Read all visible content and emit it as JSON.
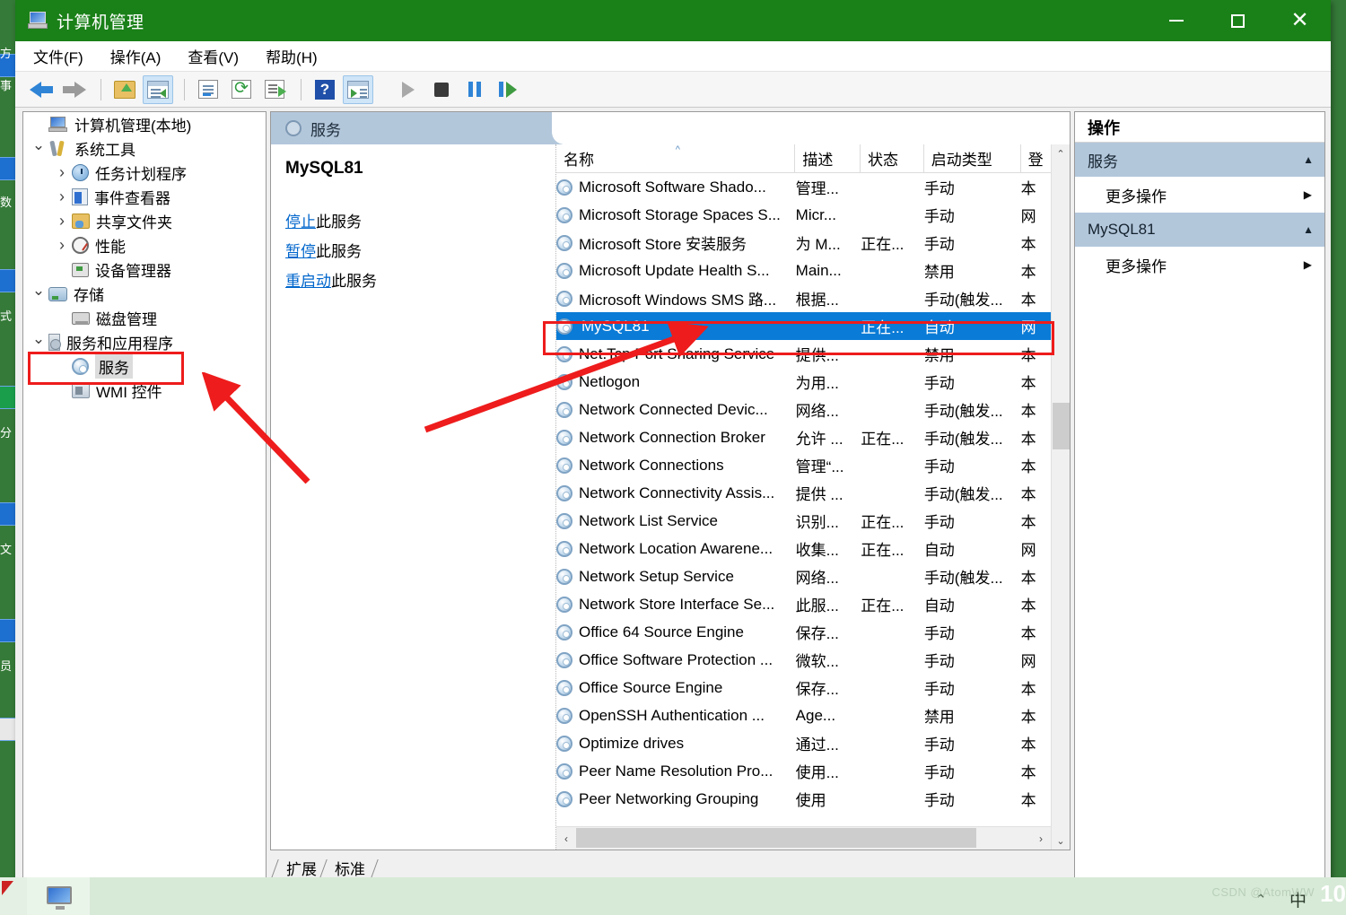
{
  "window": {
    "title": "计算机管理",
    "title_icon": "computer-management-icon",
    "controls": {
      "minimize": "最小化",
      "maximize": "最大化",
      "close": "关闭"
    }
  },
  "menubar": [
    {
      "name": "file",
      "label": "文件(F)"
    },
    {
      "name": "action",
      "label": "操作(A)"
    },
    {
      "name": "view",
      "label": "查看(V)"
    },
    {
      "name": "help",
      "label": "帮助(H)"
    }
  ],
  "toolbar": [
    {
      "name": "back-icon",
      "label": "后退"
    },
    {
      "name": "forward-icon",
      "label": "前进"
    },
    {
      "name": "up-one-level-icon",
      "label": "上移一级"
    },
    {
      "name": "show-hide-tree-icon",
      "label": "显示/隐藏控制台树"
    },
    {
      "name": "properties-icon",
      "label": "属性"
    },
    {
      "name": "refresh-icon",
      "label": "刷新"
    },
    {
      "name": "export-list-icon",
      "label": "导出列表"
    },
    {
      "name": "help-icon",
      "label": "帮助"
    },
    {
      "name": "show-action-pane-icon",
      "label": "显示/隐藏操作窗格"
    },
    {
      "name": "start-service-icon",
      "label": "启动服务"
    },
    {
      "name": "stop-service-icon",
      "label": "停止服务"
    },
    {
      "name": "pause-service-icon",
      "label": "暂停服务"
    },
    {
      "name": "restart-service-icon",
      "label": "重新启动服务"
    }
  ],
  "tree": {
    "root": {
      "label": "计算机管理(本地)",
      "icon": "computer-icon"
    },
    "items": [
      {
        "label": "系统工具",
        "icon": "tools-icon",
        "indent": 1,
        "twisty": "expanded"
      },
      {
        "label": "任务计划程序",
        "icon": "clock-icon",
        "indent": 2,
        "twisty": "collapsed"
      },
      {
        "label": "事件查看器",
        "icon": "event-viewer-icon",
        "indent": 2,
        "twisty": "collapsed"
      },
      {
        "label": "共享文件夹",
        "icon": "shared-folder-icon",
        "indent": 2,
        "twisty": "collapsed"
      },
      {
        "label": "性能",
        "icon": "performance-icon",
        "indent": 2,
        "twisty": "collapsed"
      },
      {
        "label": "设备管理器",
        "icon": "device-manager-icon",
        "indent": 2,
        "twisty": "none"
      },
      {
        "label": "存储",
        "icon": "storage-icon",
        "indent": 1,
        "twisty": "expanded"
      },
      {
        "label": "磁盘管理",
        "icon": "disk-management-icon",
        "indent": 2,
        "twisty": "none"
      },
      {
        "label": "服务和应用程序",
        "icon": "services-apps-icon",
        "indent": 1,
        "twisty": "expanded"
      },
      {
        "label": "服务",
        "icon": "services-gear-icon",
        "indent": 2,
        "twisty": "none",
        "selected": true
      },
      {
        "label": "WMI 控件",
        "icon": "wmi-control-icon",
        "indent": 2,
        "twisty": "none"
      }
    ]
  },
  "center": {
    "header_title": "服务",
    "header_icon": "services-gear-icon",
    "detail": {
      "title": "MySQL81",
      "links": [
        {
          "link_text": "停止",
          "suffix": "此服务"
        },
        {
          "link_text": "暂停",
          "suffix": "此服务"
        },
        {
          "link_text": "重启动",
          "suffix": "此服务"
        }
      ]
    },
    "columns": [
      {
        "key": "name",
        "label": "名称",
        "sorted": true,
        "sort_mark": "^"
      },
      {
        "key": "description",
        "label": "描述"
      },
      {
        "key": "status",
        "label": "状态"
      },
      {
        "key": "startup_type",
        "label": "启动类型"
      },
      {
        "key": "log_on_as",
        "label": "登"
      }
    ],
    "rows": [
      {
        "name": "Microsoft Software Shado...",
        "description": "管理...",
        "status": "",
        "startup_type": "手动",
        "log_on_as": "本",
        "selected": false
      },
      {
        "name": "Microsoft Storage Spaces S...",
        "description": "Micr...",
        "status": "",
        "startup_type": "手动",
        "log_on_as": "网",
        "selected": false
      },
      {
        "name": "Microsoft Store 安装服务",
        "description": "为 M...",
        "status": "正在...",
        "startup_type": "手动",
        "log_on_as": "本",
        "selected": false
      },
      {
        "name": "Microsoft Update Health S...",
        "description": "Main...",
        "status": "",
        "startup_type": "禁用",
        "log_on_as": "本",
        "selected": false
      },
      {
        "name": "Microsoft Windows SMS 路...",
        "description": "根据...",
        "status": "",
        "startup_type": "手动(触发...",
        "log_on_as": "本",
        "selected": false
      },
      {
        "name": "MySQL81",
        "description": "",
        "status": "正在...",
        "startup_type": "自动",
        "log_on_as": "网",
        "selected": true
      },
      {
        "name": "Net.Tcp Port Sharing Service",
        "description": "提供...",
        "status": "",
        "startup_type": "禁用",
        "log_on_as": "本",
        "selected": false
      },
      {
        "name": "Netlogon",
        "description": "为用...",
        "status": "",
        "startup_type": "手动",
        "log_on_as": "本",
        "selected": false
      },
      {
        "name": "Network Connected Devic...",
        "description": "网络...",
        "status": "",
        "startup_type": "手动(触发...",
        "log_on_as": "本",
        "selected": false
      },
      {
        "name": "Network Connection Broker",
        "description": "允许 ...",
        "status": "正在...",
        "startup_type": "手动(触发...",
        "log_on_as": "本",
        "selected": false
      },
      {
        "name": "Network Connections",
        "description": "管理“...",
        "status": "",
        "startup_type": "手动",
        "log_on_as": "本",
        "selected": false
      },
      {
        "name": "Network Connectivity Assis...",
        "description": "提供 ...",
        "status": "",
        "startup_type": "手动(触发...",
        "log_on_as": "本",
        "selected": false
      },
      {
        "name": "Network List Service",
        "description": "识别...",
        "status": "正在...",
        "startup_type": "手动",
        "log_on_as": "本",
        "selected": false
      },
      {
        "name": "Network Location Awarene...",
        "description": "收集...",
        "status": "正在...",
        "startup_type": "自动",
        "log_on_as": "网",
        "selected": false
      },
      {
        "name": "Network Setup Service",
        "description": "网络...",
        "status": "",
        "startup_type": "手动(触发...",
        "log_on_as": "本",
        "selected": false
      },
      {
        "name": "Network Store Interface Se...",
        "description": "此服...",
        "status": "正在...",
        "startup_type": "自动",
        "log_on_as": "本",
        "selected": false
      },
      {
        "name": "Office 64 Source Engine",
        "description": "保存...",
        "status": "",
        "startup_type": "手动",
        "log_on_as": "本",
        "selected": false
      },
      {
        "name": "Office Software Protection ...",
        "description": "微软...",
        "status": "",
        "startup_type": "手动",
        "log_on_as": "网",
        "selected": false
      },
      {
        "name": "Office Source Engine",
        "description": "保存...",
        "status": "",
        "startup_type": "手动",
        "log_on_as": "本",
        "selected": false
      },
      {
        "name": "OpenSSH Authentication ...",
        "description": "Age...",
        "status": "",
        "startup_type": "禁用",
        "log_on_as": "本",
        "selected": false
      },
      {
        "name": "Optimize drives",
        "description": "通过...",
        "status": "",
        "startup_type": "手动",
        "log_on_as": "本",
        "selected": false
      },
      {
        "name": "Peer Name Resolution Pro...",
        "description": "使用...",
        "status": "",
        "startup_type": "手动",
        "log_on_as": "本",
        "selected": false
      },
      {
        "name": "Peer Networking Grouping",
        "description": "使用",
        "status": "",
        "startup_type": "手动",
        "log_on_as": "本",
        "selected": false
      }
    ],
    "view_tabs": [
      {
        "name": "extended",
        "label": "扩展"
      },
      {
        "name": "standard",
        "label": "标准",
        "active": true
      }
    ],
    "scroll": {
      "up_arrow": "⌃",
      "down_arrow": "⌄",
      "left_arrow": "‹",
      "right_arrow": "›"
    }
  },
  "actions": {
    "header": "操作",
    "groups": [
      {
        "title": "服务",
        "caret": "▲",
        "items": [
          {
            "label": "更多操作",
            "caret": "▶"
          }
        ]
      },
      {
        "title": "MySQL81",
        "caret": "▲",
        "items": [
          {
            "label": "更多操作",
            "caret": "▶"
          }
        ]
      }
    ]
  },
  "annotations": {
    "box_tree_target": "服务",
    "box_row_target": "MySQL81",
    "arrow_color": "#ee1c1c"
  },
  "desktop": {
    "background_color": "#357a38",
    "taskbar_color": "#d7ead7",
    "watermark": "CSDN @AtomWW",
    "watermark_number": "10",
    "tray_caret": "⌃",
    "tray_ime": "中",
    "left_icon_labels": [
      "方",
      "事",
      "数",
      "式",
      "分",
      "文",
      "员"
    ]
  },
  "colors": {
    "titlebar": "#1a8018",
    "selection": "#0a7bd6",
    "header_band": "#b3c7db",
    "link": "#0066cc",
    "annotation_red": "#ee1c1c"
  }
}
